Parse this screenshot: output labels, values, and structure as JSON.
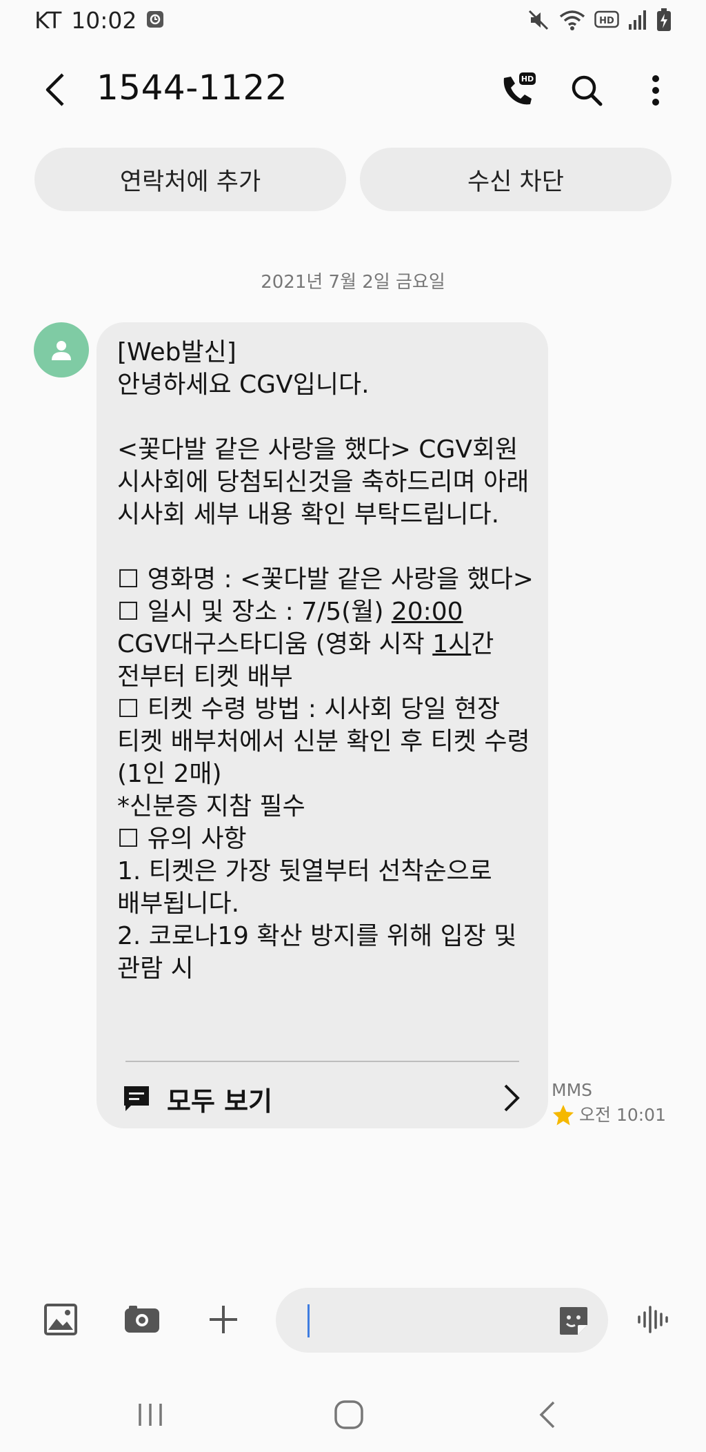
{
  "status_bar": {
    "carrier": "KT",
    "time": "10:02",
    "network_badge": "HD"
  },
  "header": {
    "title": "1544-1122",
    "call_badge": "HD"
  },
  "actions": {
    "add_contact": "연락처에 추가",
    "block": "수신 차단"
  },
  "date_divider": "2021년 7월 2일 금요일",
  "message": {
    "lines": [
      "[Web발신]",
      "안녕하세요 CGV입니다.",
      "",
      "<꽃다발 같은 사랑을 했다> CGV회원 시사회에 당첨되신것을 축하드리며 아래 시사회 세부 내용 확인 부탁드립니다.",
      "",
      "☐ 영화명 : <꽃다발 같은 사랑을 했다>",
      "☐ 일시 및 장소 : 7/5(월) ",
      "20:00",
      " CGV대구스타디움 (영화 시작 ",
      "1시",
      "간 전부터 티켓 배부",
      "☐ 티켓 수령 방법 : 시사회 당일 현장 티켓 배부처에서 신분 확인 후 티켓 수령 (1인 2매)",
      "*신분증 지참 필수",
      "☐ 유의 사항",
      "1. 티켓은 가장 뒷열부터 선착순으로 배부됩니다.",
      "2. 코로나19 확산 방지를 위해 입장 및 관람 시"
    ],
    "view_all": "모두 보기",
    "type": "MMS",
    "time": "오전 10:01"
  },
  "composer": {
    "placeholder": ""
  },
  "colors": {
    "avatar": "#7fcba4",
    "star": "#f5b800",
    "caret": "#3f7de0",
    "bubble": "#ececec"
  }
}
